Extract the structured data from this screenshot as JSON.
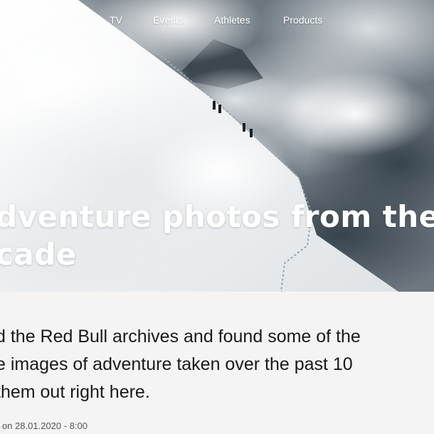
{
  "nav": {
    "items": [
      "TV",
      "Events",
      "Athletes",
      "Products"
    ]
  },
  "hero": {
    "title_lines": [
      "dventure photos from the",
      "cade"
    ]
  },
  "article": {
    "lede_lines": [
      "d the Red Bull archives and found some of the",
      "e images of adventure taken over the past 10",
      "them out right here."
    ],
    "published": "on 28.01.2020 - 8:00"
  },
  "colors": {
    "text_dark": "#1a1a1a",
    "meta_text": "#555555",
    "page_bg": "#f4f4f4",
    "hero_text": "#ffffff"
  }
}
